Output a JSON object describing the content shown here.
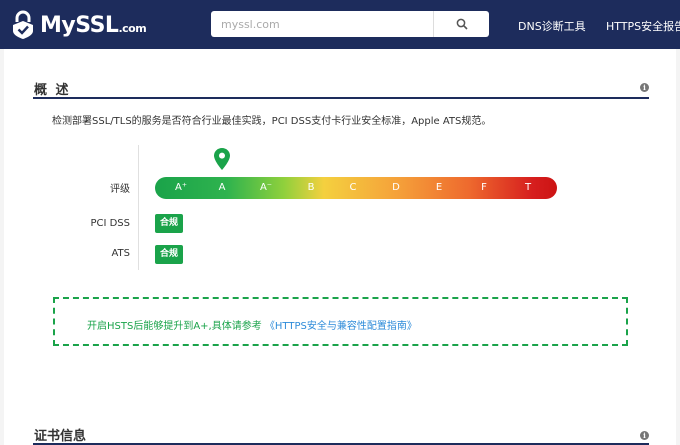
{
  "header": {
    "logo_text": "MySSL",
    "logo_suffix": ".com",
    "search_placeholder": "myssl.com",
    "nav": [
      "DNS诊断工具",
      "HTTPS安全报告"
    ]
  },
  "overview": {
    "title": "概 述",
    "description": "检测部署SSL/TLS的服务是否符合行业最佳实践，PCI DSS支付卡行业安全标准，Apple ATS规范。",
    "rating_label": "评级",
    "grades": [
      "A⁺",
      "A",
      "A⁻",
      "B",
      "C",
      "D",
      "E",
      "F",
      "T"
    ],
    "current_grade": "A",
    "pci_label": "PCI DSS",
    "pci_status": "合规",
    "ats_label": "ATS",
    "ats_status": "合规",
    "tip_text": "开启HSTS后能够提升到A+,具体请参考 ",
    "tip_link": "《HTTPS安全与兼容性配置指南》"
  },
  "certificate": {
    "title": "证书信息"
  },
  "colors": {
    "header_bg": "#1d2c5c",
    "pass_green": "#1aa34a",
    "link_blue": "#2d8bd9"
  }
}
